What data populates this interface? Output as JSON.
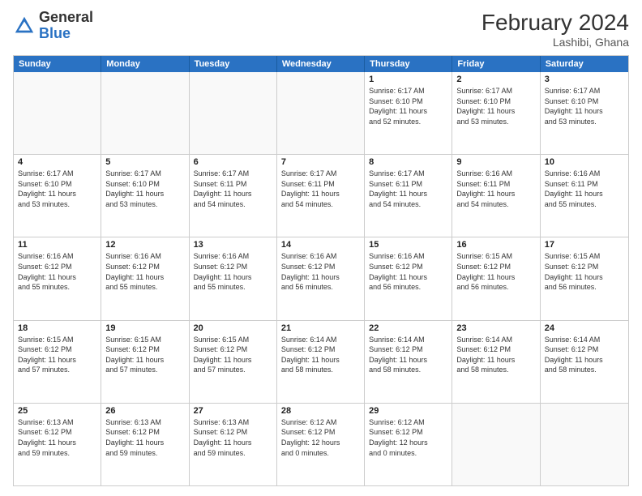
{
  "logo": {
    "general": "General",
    "blue": "Blue"
  },
  "header": {
    "month_year": "February 2024",
    "location": "Lashibi, Ghana"
  },
  "weekdays": [
    "Sunday",
    "Monday",
    "Tuesday",
    "Wednesday",
    "Thursday",
    "Friday",
    "Saturday"
  ],
  "rows": [
    [
      {
        "day": "",
        "info": ""
      },
      {
        "day": "",
        "info": ""
      },
      {
        "day": "",
        "info": ""
      },
      {
        "day": "",
        "info": ""
      },
      {
        "day": "1",
        "info": "Sunrise: 6:17 AM\nSunset: 6:10 PM\nDaylight: 11 hours\nand 52 minutes."
      },
      {
        "day": "2",
        "info": "Sunrise: 6:17 AM\nSunset: 6:10 PM\nDaylight: 11 hours\nand 53 minutes."
      },
      {
        "day": "3",
        "info": "Sunrise: 6:17 AM\nSunset: 6:10 PM\nDaylight: 11 hours\nand 53 minutes."
      }
    ],
    [
      {
        "day": "4",
        "info": "Sunrise: 6:17 AM\nSunset: 6:10 PM\nDaylight: 11 hours\nand 53 minutes."
      },
      {
        "day": "5",
        "info": "Sunrise: 6:17 AM\nSunset: 6:10 PM\nDaylight: 11 hours\nand 53 minutes."
      },
      {
        "day": "6",
        "info": "Sunrise: 6:17 AM\nSunset: 6:11 PM\nDaylight: 11 hours\nand 54 minutes."
      },
      {
        "day": "7",
        "info": "Sunrise: 6:17 AM\nSunset: 6:11 PM\nDaylight: 11 hours\nand 54 minutes."
      },
      {
        "day": "8",
        "info": "Sunrise: 6:17 AM\nSunset: 6:11 PM\nDaylight: 11 hours\nand 54 minutes."
      },
      {
        "day": "9",
        "info": "Sunrise: 6:16 AM\nSunset: 6:11 PM\nDaylight: 11 hours\nand 54 minutes."
      },
      {
        "day": "10",
        "info": "Sunrise: 6:16 AM\nSunset: 6:11 PM\nDaylight: 11 hours\nand 55 minutes."
      }
    ],
    [
      {
        "day": "11",
        "info": "Sunrise: 6:16 AM\nSunset: 6:12 PM\nDaylight: 11 hours\nand 55 minutes."
      },
      {
        "day": "12",
        "info": "Sunrise: 6:16 AM\nSunset: 6:12 PM\nDaylight: 11 hours\nand 55 minutes."
      },
      {
        "day": "13",
        "info": "Sunrise: 6:16 AM\nSunset: 6:12 PM\nDaylight: 11 hours\nand 55 minutes."
      },
      {
        "day": "14",
        "info": "Sunrise: 6:16 AM\nSunset: 6:12 PM\nDaylight: 11 hours\nand 56 minutes."
      },
      {
        "day": "15",
        "info": "Sunrise: 6:16 AM\nSunset: 6:12 PM\nDaylight: 11 hours\nand 56 minutes."
      },
      {
        "day": "16",
        "info": "Sunrise: 6:15 AM\nSunset: 6:12 PM\nDaylight: 11 hours\nand 56 minutes."
      },
      {
        "day": "17",
        "info": "Sunrise: 6:15 AM\nSunset: 6:12 PM\nDaylight: 11 hours\nand 56 minutes."
      }
    ],
    [
      {
        "day": "18",
        "info": "Sunrise: 6:15 AM\nSunset: 6:12 PM\nDaylight: 11 hours\nand 57 minutes."
      },
      {
        "day": "19",
        "info": "Sunrise: 6:15 AM\nSunset: 6:12 PM\nDaylight: 11 hours\nand 57 minutes."
      },
      {
        "day": "20",
        "info": "Sunrise: 6:15 AM\nSunset: 6:12 PM\nDaylight: 11 hours\nand 57 minutes."
      },
      {
        "day": "21",
        "info": "Sunrise: 6:14 AM\nSunset: 6:12 PM\nDaylight: 11 hours\nand 58 minutes."
      },
      {
        "day": "22",
        "info": "Sunrise: 6:14 AM\nSunset: 6:12 PM\nDaylight: 11 hours\nand 58 minutes."
      },
      {
        "day": "23",
        "info": "Sunrise: 6:14 AM\nSunset: 6:12 PM\nDaylight: 11 hours\nand 58 minutes."
      },
      {
        "day": "24",
        "info": "Sunrise: 6:14 AM\nSunset: 6:12 PM\nDaylight: 11 hours\nand 58 minutes."
      }
    ],
    [
      {
        "day": "25",
        "info": "Sunrise: 6:13 AM\nSunset: 6:12 PM\nDaylight: 11 hours\nand 59 minutes."
      },
      {
        "day": "26",
        "info": "Sunrise: 6:13 AM\nSunset: 6:12 PM\nDaylight: 11 hours\nand 59 minutes."
      },
      {
        "day": "27",
        "info": "Sunrise: 6:13 AM\nSunset: 6:12 PM\nDaylight: 11 hours\nand 59 minutes."
      },
      {
        "day": "28",
        "info": "Sunrise: 6:12 AM\nSunset: 6:12 PM\nDaylight: 12 hours\nand 0 minutes."
      },
      {
        "day": "29",
        "info": "Sunrise: 6:12 AM\nSunset: 6:12 PM\nDaylight: 12 hours\nand 0 minutes."
      },
      {
        "day": "",
        "info": ""
      },
      {
        "day": "",
        "info": ""
      }
    ]
  ]
}
